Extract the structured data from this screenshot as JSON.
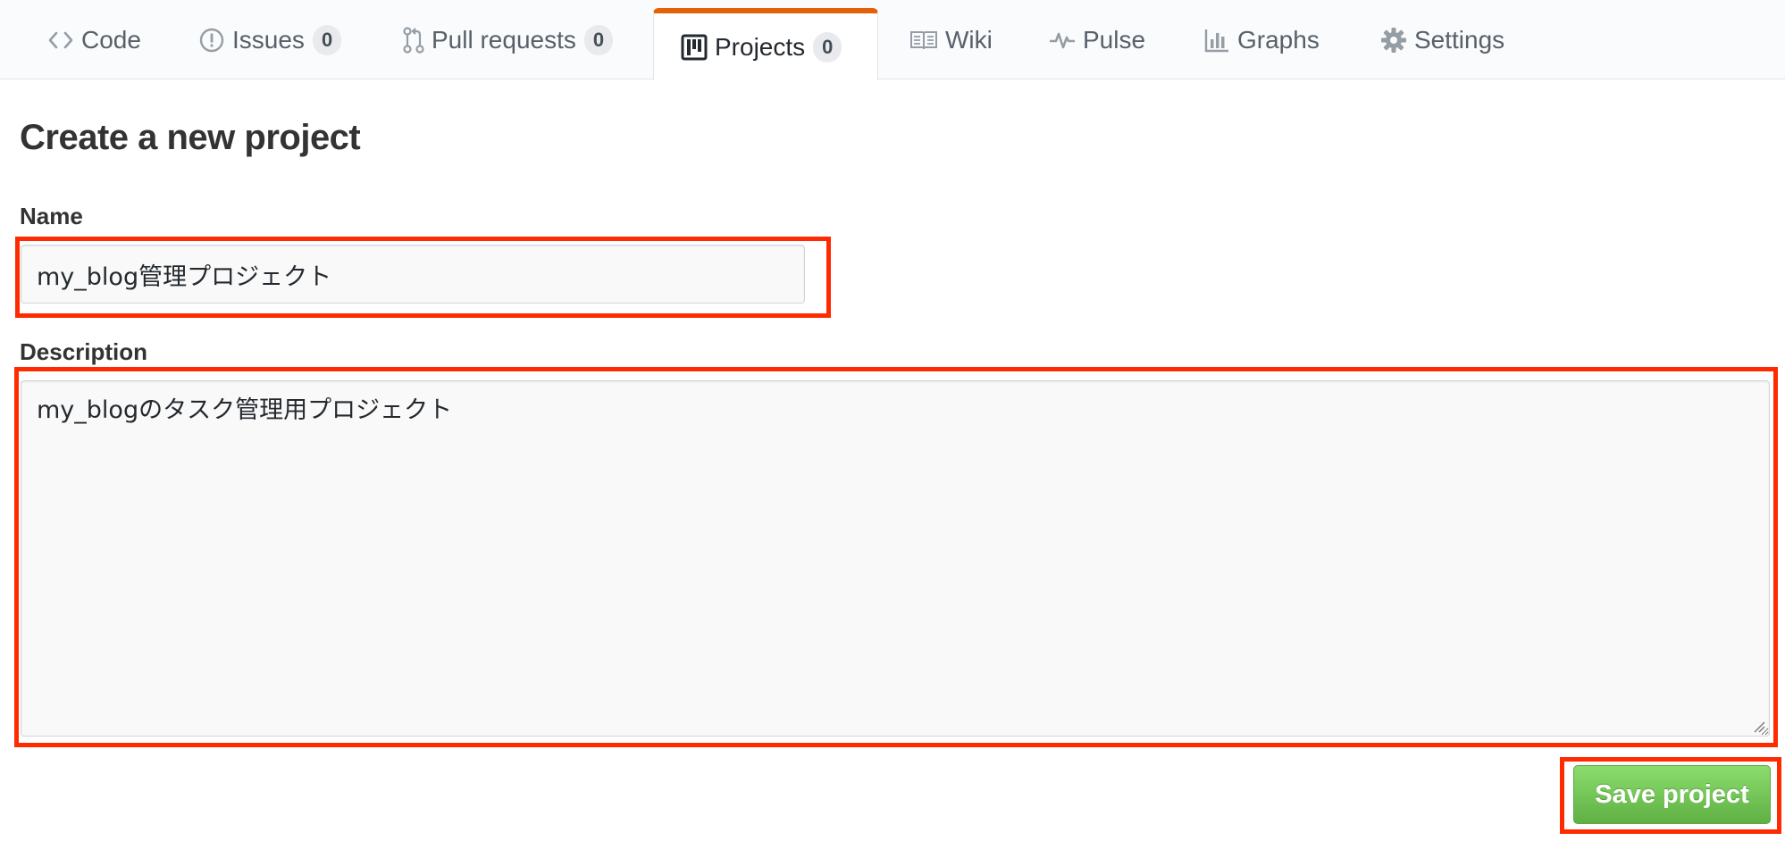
{
  "nav": {
    "tabs": [
      {
        "label": "Code",
        "icon": "code-icon"
      },
      {
        "label": "Issues",
        "icon": "issue-opened-icon",
        "count": "0"
      },
      {
        "label": "Pull requests",
        "icon": "git-pull-request-icon",
        "count": "0"
      },
      {
        "label": "Projects",
        "icon": "project-icon",
        "count": "0",
        "selected": true
      },
      {
        "label": "Wiki",
        "icon": "book-icon"
      },
      {
        "label": "Pulse",
        "icon": "pulse-icon"
      },
      {
        "label": "Graphs",
        "icon": "graph-icon"
      },
      {
        "label": "Settings",
        "icon": "gear-icon"
      }
    ]
  },
  "form": {
    "title": "Create a new project",
    "name_label": "Name",
    "name_value": "my_blog管理プロジェクト",
    "description_label": "Description",
    "description_value": "my_blogのタスク管理用プロジェクト",
    "save_label": "Save project"
  },
  "colors": {
    "accent_tab": "#e36209",
    "annotation": "#ff2a00",
    "save_button": "#60b044"
  }
}
